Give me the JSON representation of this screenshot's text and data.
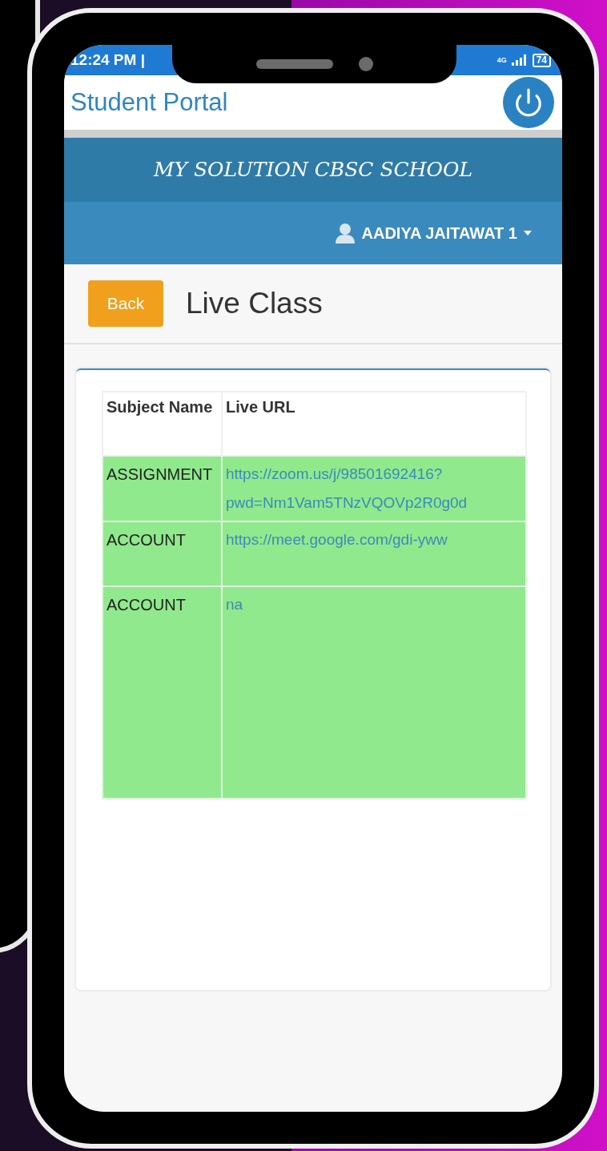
{
  "status_bar": {
    "time": "12:24 PM |",
    "network": "4G",
    "battery": "74"
  },
  "app_bar": {
    "title": "Student Portal"
  },
  "banner": {
    "school": "MY SOLUTION CBSC SCHOOL"
  },
  "user_menu": {
    "name": "AADIYA JAITAWAT 1"
  },
  "page": {
    "back": "Back",
    "title": "Live Class"
  },
  "table": {
    "columns": [
      "Subject Name",
      "Live URL"
    ],
    "rows": [
      {
        "subject": "ASSIGNMENT",
        "url": "https://zoom.us/j/98501692416?pwd=Nm1Vam5TNzVQOVp2R0g0d"
      },
      {
        "subject": "ACCOUNT",
        "url": "https://meet.google.com/gdi-yww"
      },
      {
        "subject": "ACCOUNT",
        "url": "na"
      }
    ]
  }
}
